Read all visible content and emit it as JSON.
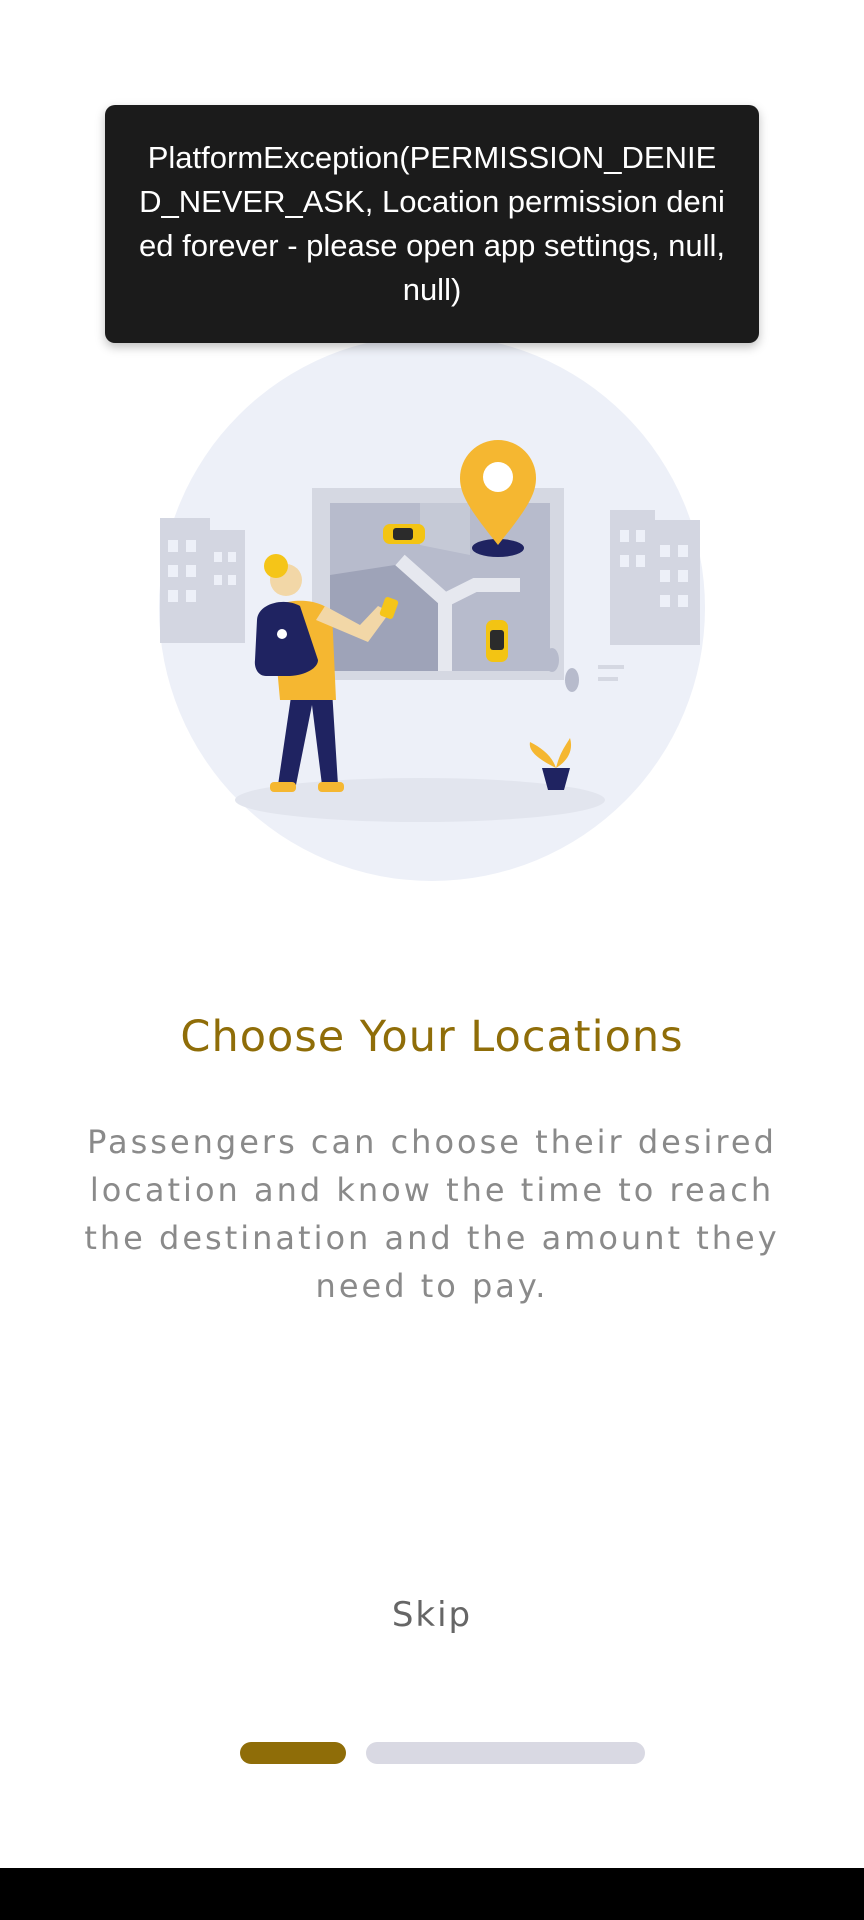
{
  "toast": {
    "message": "PlatformException(PERMISSION_DENIED_NEVER_ASK, Location permission denied forever - please open app settings, null, null)"
  },
  "onboarding": {
    "title": "Choose Your Locations",
    "description": "Passengers can choose their desired location and know the time to reach the destination and the amount they need to pay.",
    "skip_label": "Skip",
    "current_page": 1,
    "total_pages": 3
  },
  "colors": {
    "accent": "#8f6d08",
    "inactive_dot": "#d9d9e3",
    "toast_bg": "#1b1b1b"
  }
}
